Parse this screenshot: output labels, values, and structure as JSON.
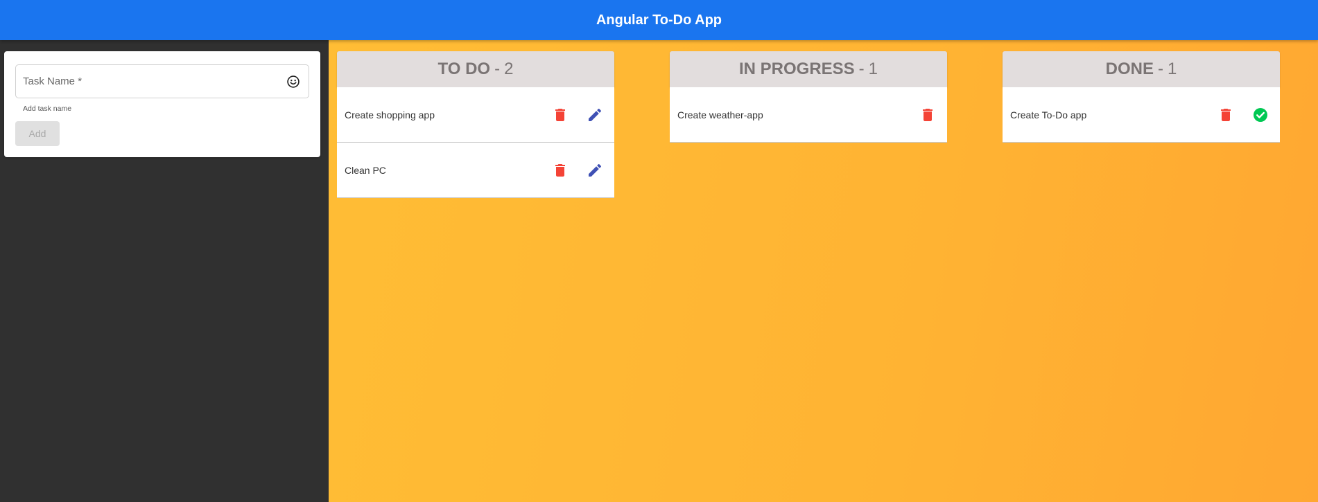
{
  "header": {
    "title": "Angular To-Do App"
  },
  "form": {
    "placeholder": "Task Name *",
    "value": "",
    "hint": "Add task name",
    "add_label": "Add",
    "emoji_icon": "emoji-icon"
  },
  "columns": [
    {
      "title": "TO DO",
      "separator": "-",
      "count": "2",
      "cards": [
        {
          "text": "Create shopping app",
          "actions": [
            "delete-icon",
            "edit-icon"
          ]
        },
        {
          "text": "Clean PC",
          "actions": [
            "delete-icon",
            "edit-icon"
          ]
        }
      ]
    },
    {
      "title": "IN PROGRESS",
      "separator": "-",
      "count": "1",
      "cards": [
        {
          "text": "Create weather-app",
          "actions": [
            "delete-icon"
          ]
        }
      ]
    },
    {
      "title": "DONE",
      "separator": "-",
      "count": "1",
      "cards": [
        {
          "text": "Create To-Do app",
          "actions": [
            "delete-icon",
            "check-circle-icon"
          ]
        }
      ]
    }
  ],
  "colors": {
    "header": "#1a75ef",
    "sidebar": "#303030",
    "board_start": "#ffbd35",
    "board_end": "#ffa732",
    "delete": "#f44336",
    "edit": "#3f51b5",
    "done": "#00c853"
  }
}
